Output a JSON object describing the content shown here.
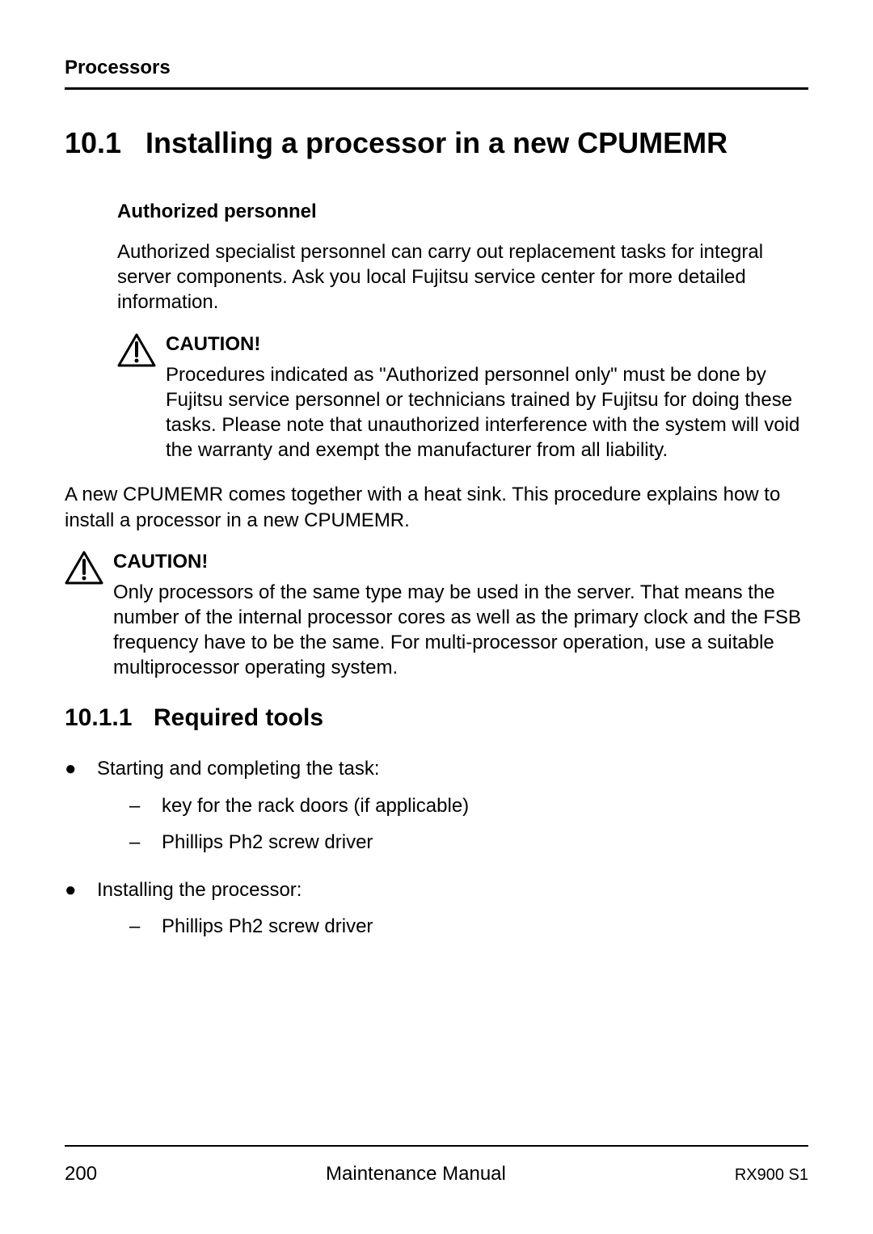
{
  "header": {
    "section": "Processors"
  },
  "section": {
    "number": "10.1",
    "title": "Installing a processor in a new CPUMEMR"
  },
  "authorized": {
    "heading": "Authorized personnel",
    "text": "Authorized specialist personnel can carry out replacement tasks for integral server components. Ask you local Fujitsu service center for more detailed information."
  },
  "caution1": {
    "label": "CAUTION!",
    "text": "Procedures indicated as \"Authorized personnel only\" must be done by Fujitsu service personnel or technicians trained by Fujitsu for doing these tasks. Please note that unauthorized interference with the system will void the warranty and exempt the manufacturer from all liability."
  },
  "intro_text": "A new CPUMEMR comes together with a heat sink. This procedure explains how to install a processor in a new CPUMEMR.",
  "caution2": {
    "label": "CAUTION!",
    "text": "Only processors of the same type may be used in the server. That means the number of the internal processor cores as well as the primary clock and the FSB frequency have to be the same. For multi-processor operation, use a suitable multiprocessor operating system."
  },
  "subsection": {
    "number": "10.1.1",
    "title": "Required tools"
  },
  "tools": {
    "item1": {
      "label": "Starting and completing the task:",
      "sub1": "key for the rack doors (if applicable)",
      "sub2": "Phillips Ph2 screw driver"
    },
    "item2": {
      "label": " Installing the processor:",
      "sub1": "Phillips Ph2 screw driver"
    }
  },
  "footer": {
    "page": "200",
    "center": "Maintenance Manual",
    "right": "RX900 S1"
  }
}
